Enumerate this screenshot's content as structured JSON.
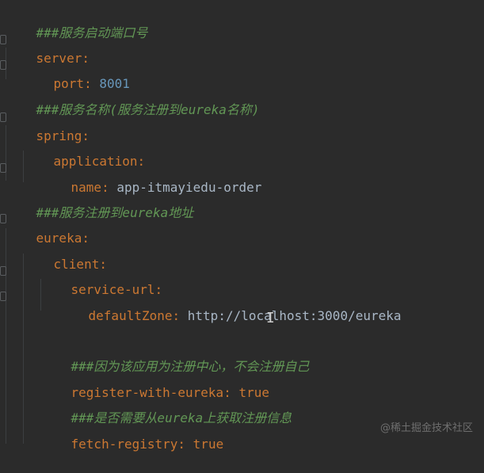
{
  "editor": {
    "lines": {
      "l1": "###服务启动端口号",
      "l2_key": "server",
      "l3_key": "port",
      "l3_val": "8001",
      "l4": "###服务名称(服务注册到eureka名称)",
      "l5_key": "spring",
      "l6_key": "application",
      "l7_key": "name",
      "l7_val": "app-itmayiedu-order",
      "l8": "###服务注册到eureka地址",
      "l9_key": "eureka",
      "l10_key": "client",
      "l11_key": "service-url",
      "l12_key": "defaultZone",
      "l12_val": "http://localhost:3000/eureka",
      "l14": "###因为该应用为注册中心，不会注册自己",
      "l15_key": "register-with-eureka",
      "l15_val": "true",
      "l16": "###是否需要从eureka上获取注册信息",
      "l17_key": "fetch-registry",
      "l17_val": "true"
    },
    "colon": ":"
  },
  "watermark": "@稀土掘金技术社区",
  "colors": {
    "background": "#2b2b2b",
    "comment": "#629755",
    "key": "#cc7832",
    "number": "#6897bb",
    "text": "#a9b7c6"
  }
}
